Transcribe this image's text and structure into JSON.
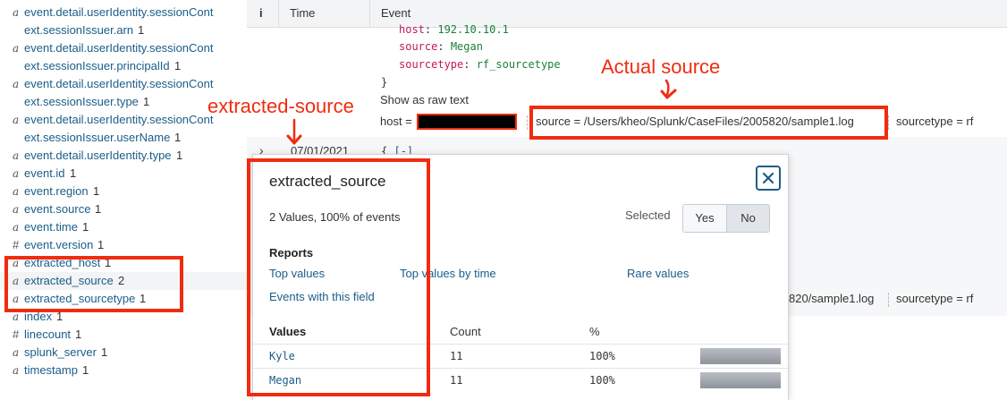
{
  "sidebar": {
    "fields": [
      {
        "type": "a",
        "name": "event.detail.userIdentity.sessionCont",
        "cont": "ext.sessionIssuer.arn",
        "count": "1"
      },
      {
        "type": "a",
        "name": "event.detail.userIdentity.sessionCont",
        "cont": "ext.sessionIssuer.principalId",
        "count": "1"
      },
      {
        "type": "a",
        "name": "event.detail.userIdentity.sessionCont",
        "cont": "ext.sessionIssuer.type",
        "count": "1"
      },
      {
        "type": "a",
        "name": "event.detail.userIdentity.sessionCont",
        "cont": "ext.sessionIssuer.userName",
        "count": "1"
      },
      {
        "type": "a",
        "name": "event.detail.userIdentity.type",
        "count": "1"
      },
      {
        "type": "a",
        "name": "event.id",
        "count": "1"
      },
      {
        "type": "a",
        "name": "event.region",
        "count": "1"
      },
      {
        "type": "a",
        "name": "event.source",
        "count": "1"
      },
      {
        "type": "a",
        "name": "event.time",
        "count": "1"
      },
      {
        "type": "#",
        "name": "event.version",
        "count": "1"
      },
      {
        "type": "a",
        "name": "extracted_host",
        "count": "1"
      },
      {
        "type": "a",
        "name": "extracted_source",
        "count": "2"
      },
      {
        "type": "a",
        "name": "extracted_sourcetype",
        "count": "1"
      },
      {
        "type": "a",
        "name": "index",
        "count": "1"
      },
      {
        "type": "#",
        "name": "linecount",
        "count": "1"
      },
      {
        "type": "a",
        "name": "splunk_server",
        "count": "1"
      },
      {
        "type": "a",
        "name": "timestamp",
        "count": "1"
      }
    ]
  },
  "table": {
    "header_info_icon": "i",
    "col_time": "Time",
    "col_event": "Event"
  },
  "event1": {
    "host_line_key": "host",
    "host_line_val": "192.10.10.1",
    "source_key": "source",
    "source_val": "Megan",
    "sourcetype_key": "sourcetype",
    "sourcetype_val": "rf_sourcetype",
    "close_brace": "}",
    "show_raw": "Show as raw text",
    "host_label": "host =",
    "source_meta": "source = /Users/kheo/Splunk/CaseFiles/2005820/sample1.log",
    "sourcetype_meta": "sourcetype = rf"
  },
  "event2": {
    "time": "07/01/2021",
    "open_brace": "{",
    "collapse": "[-]",
    "source_meta_tail": "820/sample1.log",
    "sourcetype_meta": "sourcetype = rf"
  },
  "popover": {
    "title": "extracted_source",
    "summary": "2 Values, 100% of events",
    "selected_label": "Selected",
    "yes": "Yes",
    "no": "No",
    "reports_heading": "Reports",
    "links": {
      "top_values": "Top values",
      "top_values_by_time": "Top values by time",
      "rare_values": "Rare values",
      "events_with_field": "Events with this field"
    },
    "col_values": "Values",
    "col_count": "Count",
    "col_pct": "%",
    "rows": [
      {
        "value": "Kyle",
        "count": "11",
        "pct": "100%",
        "fraction": 1.0
      },
      {
        "value": "Megan",
        "count": "11",
        "pct": "100%",
        "fraction": 1.0
      }
    ]
  },
  "annotations": {
    "actual_source": "Actual source",
    "extracted_source": "extracted-source",
    "color": "#f02c10"
  },
  "icons": [
    "close-icon",
    "chevron-right-icon",
    "arrow-down-icon"
  ]
}
